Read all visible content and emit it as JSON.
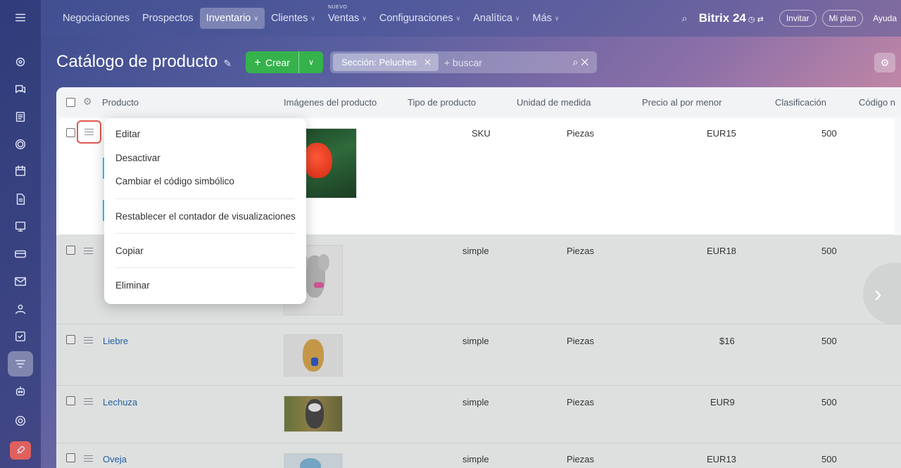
{
  "nav": {
    "items": [
      {
        "label": "Negociaciones",
        "chev": false,
        "sel": false
      },
      {
        "label": "Prospectos",
        "chev": false,
        "sel": false
      },
      {
        "label": "Inventario",
        "chev": true,
        "sel": true
      },
      {
        "label": "Clientes",
        "chev": true,
        "sel": false
      },
      {
        "label": "Ventas",
        "chev": true,
        "sel": false,
        "badge": "NUEVO"
      },
      {
        "label": "Configuraciones",
        "chev": true,
        "sel": false
      },
      {
        "label": "Analítica",
        "chev": true,
        "sel": false
      },
      {
        "label": "Más",
        "chev": true,
        "sel": false
      }
    ],
    "brand": "Bitrix 24",
    "invite": "Invitar",
    "plan": "Mi plan",
    "help": "Ayuda"
  },
  "header": {
    "title": "Catálogo de producto",
    "create_label": "Crear",
    "filter_chip": "Sección: Peluches",
    "search_placeholder": "+ buscar"
  },
  "columns": {
    "product": "Producto",
    "images": "Imágenes del producto",
    "type": "Tipo de producto",
    "unit": "Unidad de medida",
    "price": "Precio al por menor",
    "rating": "Clasificación",
    "code": "Código n"
  },
  "rows": [
    {
      "name": "",
      "type": "SKU",
      "unit": "Piezas",
      "price": "EUR15",
      "rating": "500"
    },
    {
      "name": "",
      "type": "simple",
      "unit": "Piezas",
      "price": "EUR18",
      "rating": "500"
    },
    {
      "name": "Liebre",
      "type": "simple",
      "unit": "Piezas",
      "price": "$16",
      "rating": "500"
    },
    {
      "name": "Lechuza",
      "type": "simple",
      "unit": "Piezas",
      "price": "EUR9",
      "rating": "500"
    },
    {
      "name": "Oveja",
      "type": "simple",
      "unit": "Piezas",
      "price": "EUR13",
      "rating": "500"
    }
  ],
  "context_menu": {
    "edit": "Editar",
    "deactivate": "Desactivar",
    "change_code": "Cambiar el código simbólico",
    "reset_counter": "Restablecer el contador de visualizaciones",
    "copy": "Copiar",
    "delete": "Eliminar"
  },
  "colors": {
    "accent": "#35b24b",
    "highlight": "#e0584e",
    "link": "#2067b0"
  }
}
